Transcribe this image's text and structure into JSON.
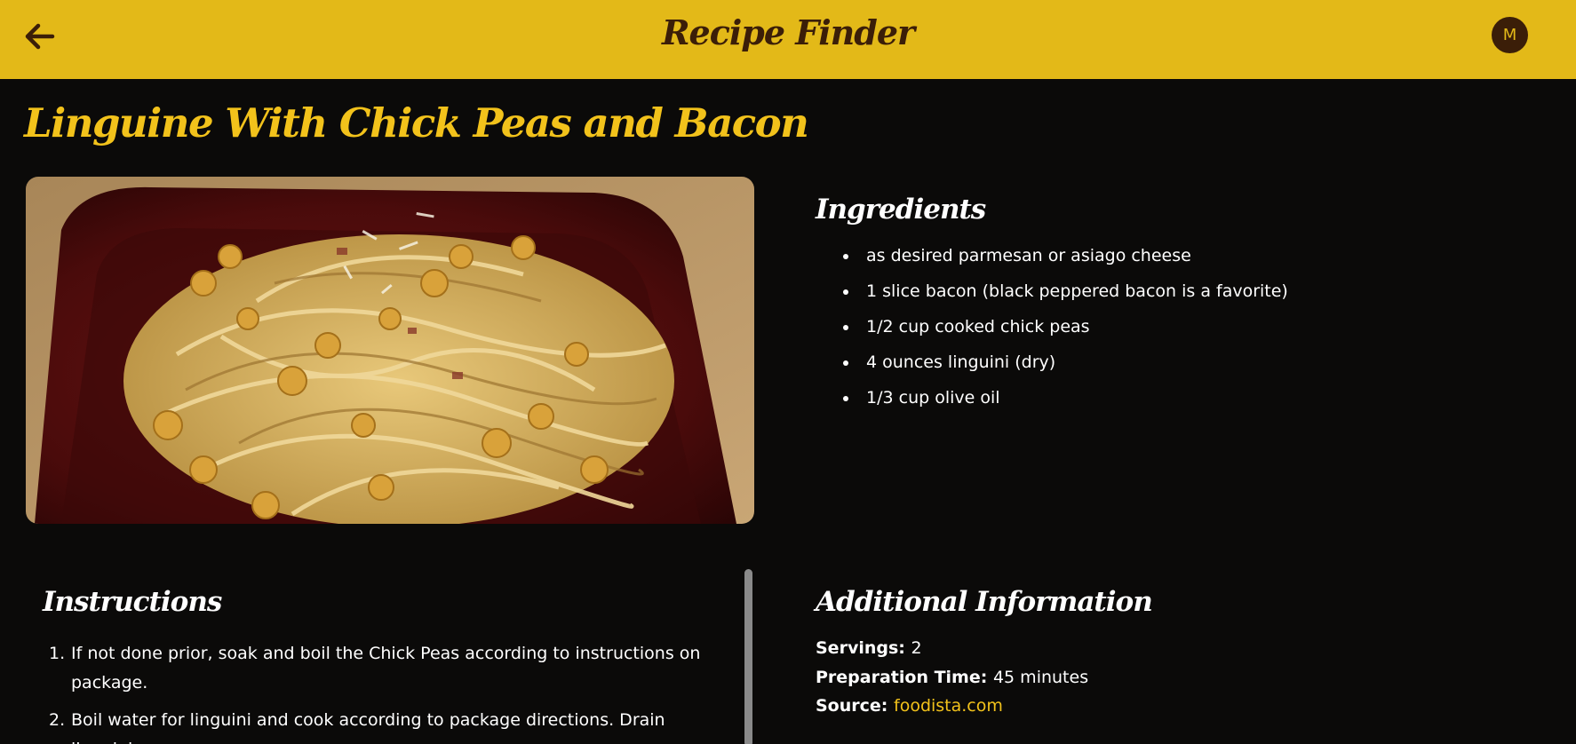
{
  "header": {
    "app_title": "Recipe Finder",
    "avatar_initial": "M"
  },
  "recipe": {
    "title": "Linguine With Chick Peas and Bacon"
  },
  "ingredients": {
    "heading": "Ingredients",
    "items": [
      "as desired parmesan or asiago cheese",
      "1 slice bacon (black peppered bacon is a favorite)",
      "1/2 cup cooked chick peas",
      "4 ounces linguini (dry)",
      "1/3 cup olive oil"
    ]
  },
  "instructions": {
    "heading": "Instructions",
    "steps": [
      "If not done prior, soak and boil the Chick Peas according to instructions on package.",
      "Boil water for linguini and cook according to package directions. Drain linguini."
    ]
  },
  "additional": {
    "heading": "Additional Information",
    "servings_label": "Servings:",
    "servings_value": "2",
    "prep_label": "Preparation Time:",
    "prep_value": "45 minutes",
    "source_label": "Source:",
    "source_value": "foodista.com"
  },
  "icons": {
    "back": "arrow-left-icon"
  },
  "colors": {
    "header_bg": "#e3b918",
    "accent": "#f2c21b",
    "header_text": "#3b1e08",
    "page_bg": "#0b0a09"
  }
}
